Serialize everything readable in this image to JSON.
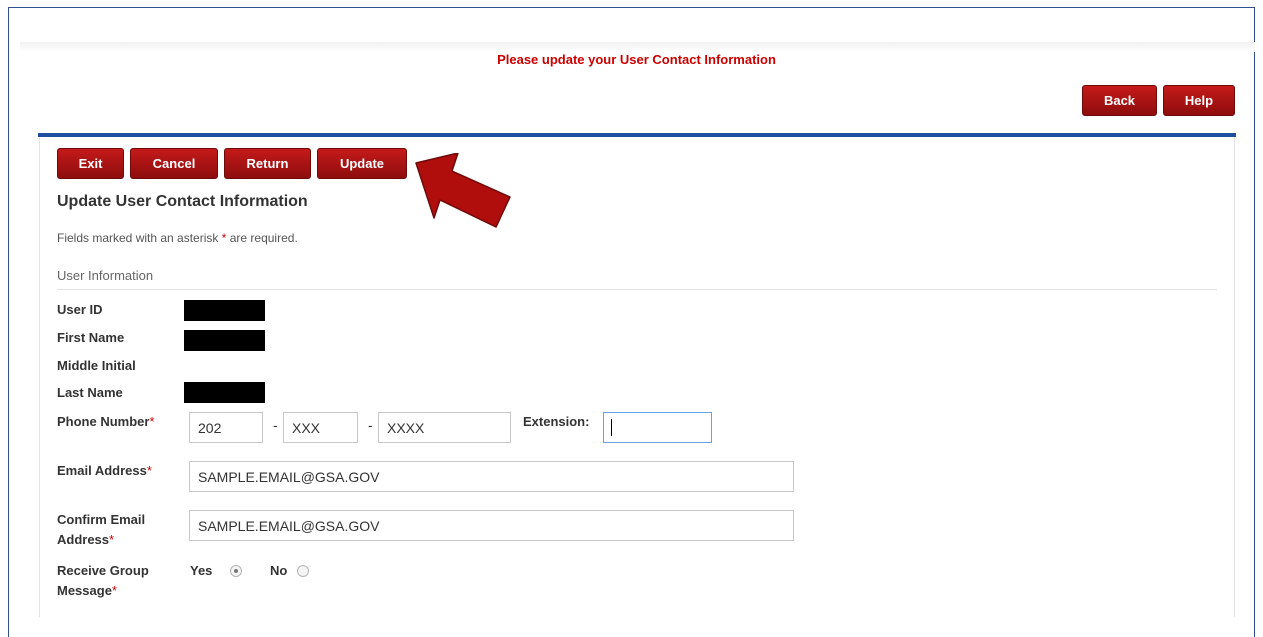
{
  "header": {
    "notice": "Please update your User Contact Information",
    "back_label": "Back",
    "help_label": "Help"
  },
  "toolbar": {
    "exit_label": "Exit",
    "cancel_label": "Cancel",
    "return_label": "Return",
    "update_label": "Update"
  },
  "form": {
    "title": "Update User Contact Information",
    "required_note_pre": "Fields marked with an asterisk ",
    "required_star": "*",
    "required_note_post": " are required.",
    "section": "User Information",
    "user_id_label": "User ID",
    "first_name_label": "First Name",
    "middle_initial_label": "Middle Initial",
    "last_name_label": "Last Name",
    "phone_label": "Phone Number",
    "phone_area": "202",
    "phone_prefix": "XXX",
    "phone_line": "XXXX",
    "dash": "-",
    "extension_label": "Extension:",
    "extension_value": "",
    "email_label": "Email Address",
    "email_value": "SAMPLE.EMAIL@GSA.GOV",
    "confirm_email_label_1": "Confirm Email",
    "confirm_email_label_2": "Address",
    "confirm_email_value": "SAMPLE.EMAIL@GSA.GOV",
    "group_msg_label_1": "Receive Group",
    "group_msg_label_2": "Message",
    "yes_label": "Yes",
    "no_label": "No",
    "group_msg_selected": "Yes"
  },
  "colors": {
    "button_red": "#a31212",
    "notice_red": "#cc0000",
    "rule_blue": "#1f4fa0"
  }
}
